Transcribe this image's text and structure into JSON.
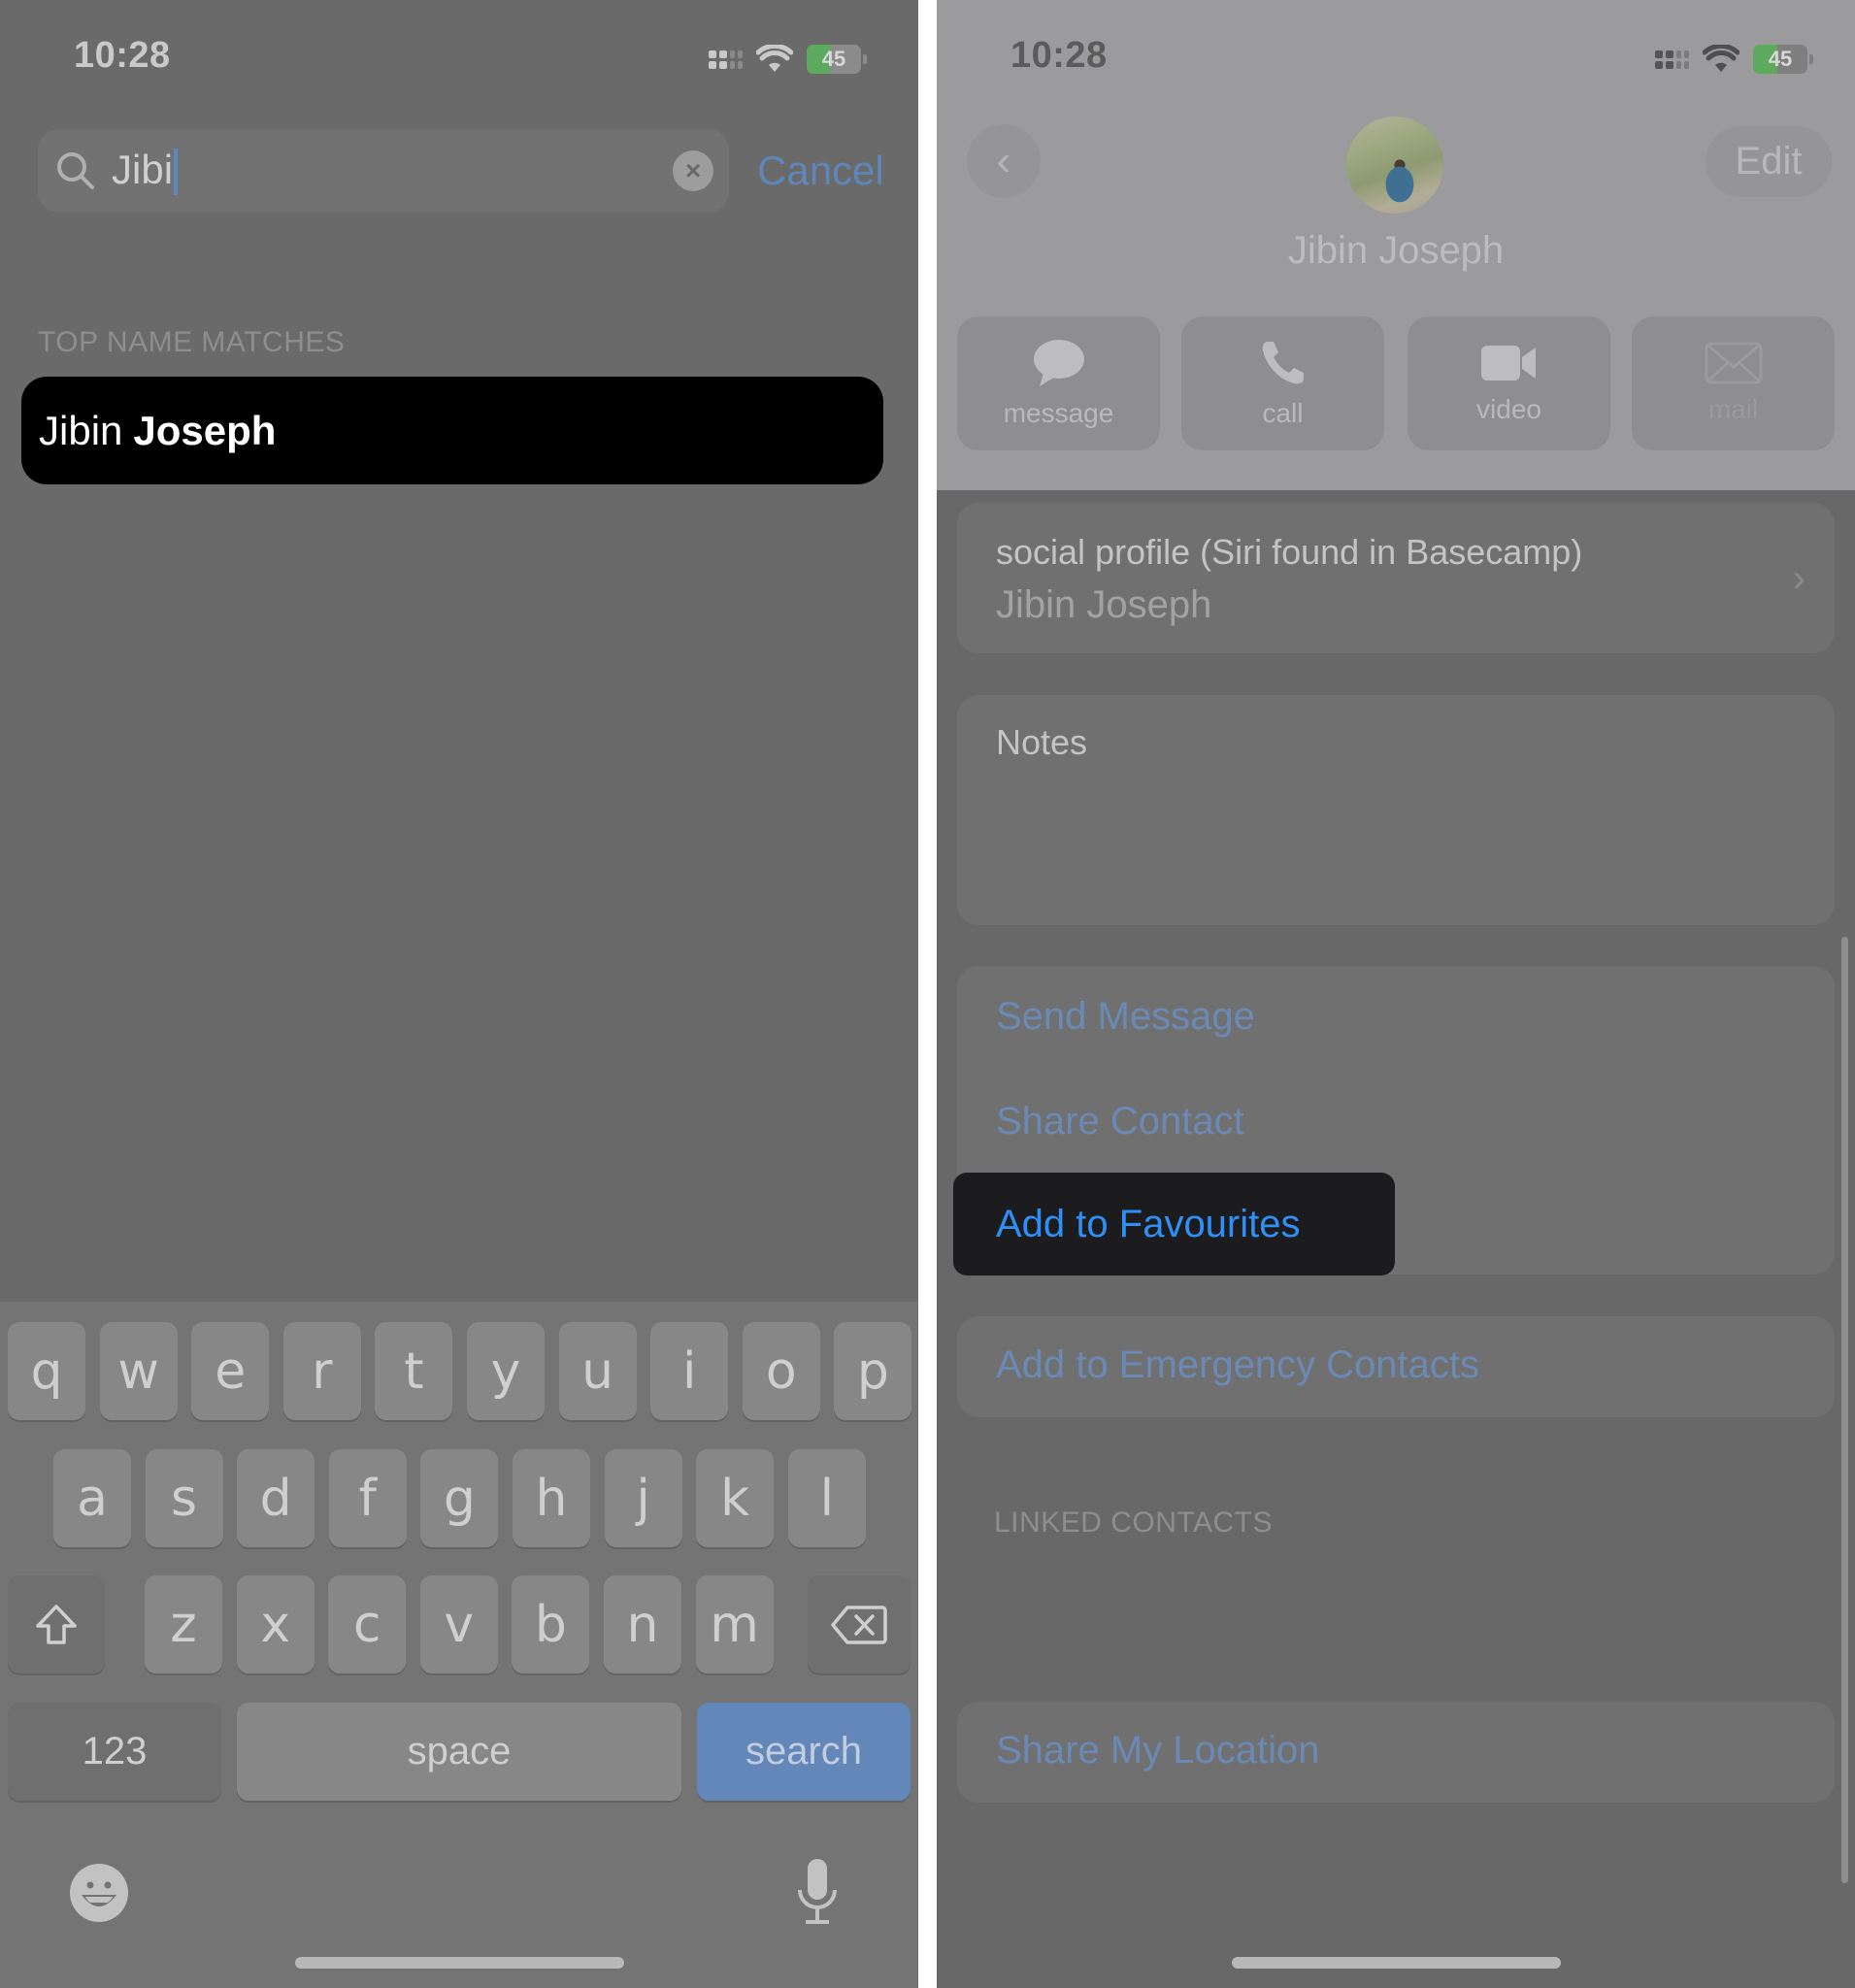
{
  "left_screen": {
    "status_bar": {
      "time": "10:28",
      "battery": "45",
      "battery_level_percent": 45,
      "icons": [
        "cellular-signal-icon",
        "wifi-icon",
        "battery-charging-icon"
      ]
    },
    "search": {
      "value": "Jibi",
      "clear_icon": "clear-circle-icon",
      "cancel_label": "Cancel"
    },
    "section_header": "TOP NAME MATCHES",
    "result": {
      "first": "Jibin",
      "last": "Joseph"
    },
    "keyboard": {
      "row1": [
        "q",
        "w",
        "e",
        "r",
        "t",
        "y",
        "u",
        "i",
        "o",
        "p"
      ],
      "row2": [
        "a",
        "s",
        "d",
        "f",
        "g",
        "h",
        "j",
        "k",
        "l"
      ],
      "row3": [
        "z",
        "x",
        "c",
        "v",
        "b",
        "n",
        "m"
      ],
      "numbers_label": "123",
      "space_label": "space",
      "search_label": "search",
      "shift_icon": "shift-icon",
      "delete_icon": "backspace-icon",
      "emoji_icon": "emoji-icon",
      "mic_icon": "microphone-icon"
    }
  },
  "right_screen": {
    "status_bar": {
      "time": "10:28",
      "battery": "45",
      "battery_level_percent": 45
    },
    "nav": {
      "back_icon": "chevron-left-icon",
      "edit_label": "Edit"
    },
    "contact_name": "Jibin Joseph",
    "actions": [
      {
        "label": "message",
        "icon": "message-bubble-icon",
        "enabled": true
      },
      {
        "label": "call",
        "icon": "phone-icon",
        "enabled": true
      },
      {
        "label": "video",
        "icon": "video-camera-icon",
        "enabled": true
      },
      {
        "label": "mail",
        "icon": "mail-envelope-icon",
        "enabled": false
      }
    ],
    "social_profile": {
      "label": "social profile (Siri found in Basecamp)",
      "value": "Jibin Joseph"
    },
    "notes_label": "Notes",
    "links": {
      "send_message": "Send Message",
      "share_contact": "Share Contact",
      "add_to_favourites": "Add to Favourites",
      "add_to_emergency": "Add to Emergency Contacts",
      "share_location": "Share My Location"
    },
    "linked_contacts_header": "LINKED CONTACTS"
  },
  "colors": {
    "accent_blue": "#2f8ff5",
    "dim_blue": "#6a8ab5",
    "battery_green": "#5daa5f"
  }
}
